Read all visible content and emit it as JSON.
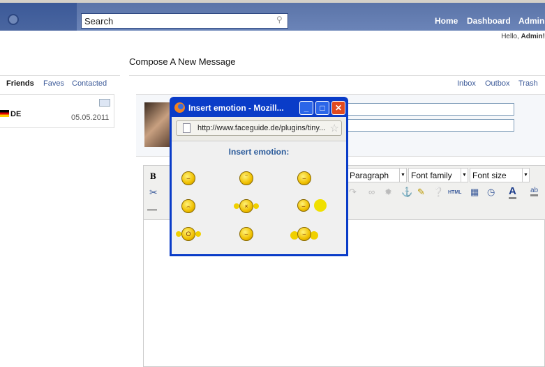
{
  "header": {
    "search_placeholder": "Search",
    "nav": [
      "Home",
      "Dashboard",
      "Admin"
    ],
    "hello_prefix": "Hello, ",
    "hello_user": "Admin!"
  },
  "page": {
    "title": "Compose A New Message"
  },
  "tabs": [
    "Friends",
    "Faves",
    "Contacted"
  ],
  "mailbox": [
    "Inbox",
    "Outbox",
    "Trash"
  ],
  "friend": {
    "country": "DE",
    "date": "05.05.2011"
  },
  "editor": {
    "format": "Paragraph",
    "font_family": "Font family",
    "font_size": "Font size",
    "bold": "B"
  },
  "popup": {
    "title": "Insert emotion - Mozill...",
    "url": "http://www.faceguide.de/plugins/tiny...",
    "heading": "Insert emotion:",
    "emotions": [
      "laughing",
      "crying",
      "grinning",
      "rock-on",
      "cheering",
      "wink-pair",
      "shouting",
      "tongue-out",
      "angel"
    ]
  }
}
